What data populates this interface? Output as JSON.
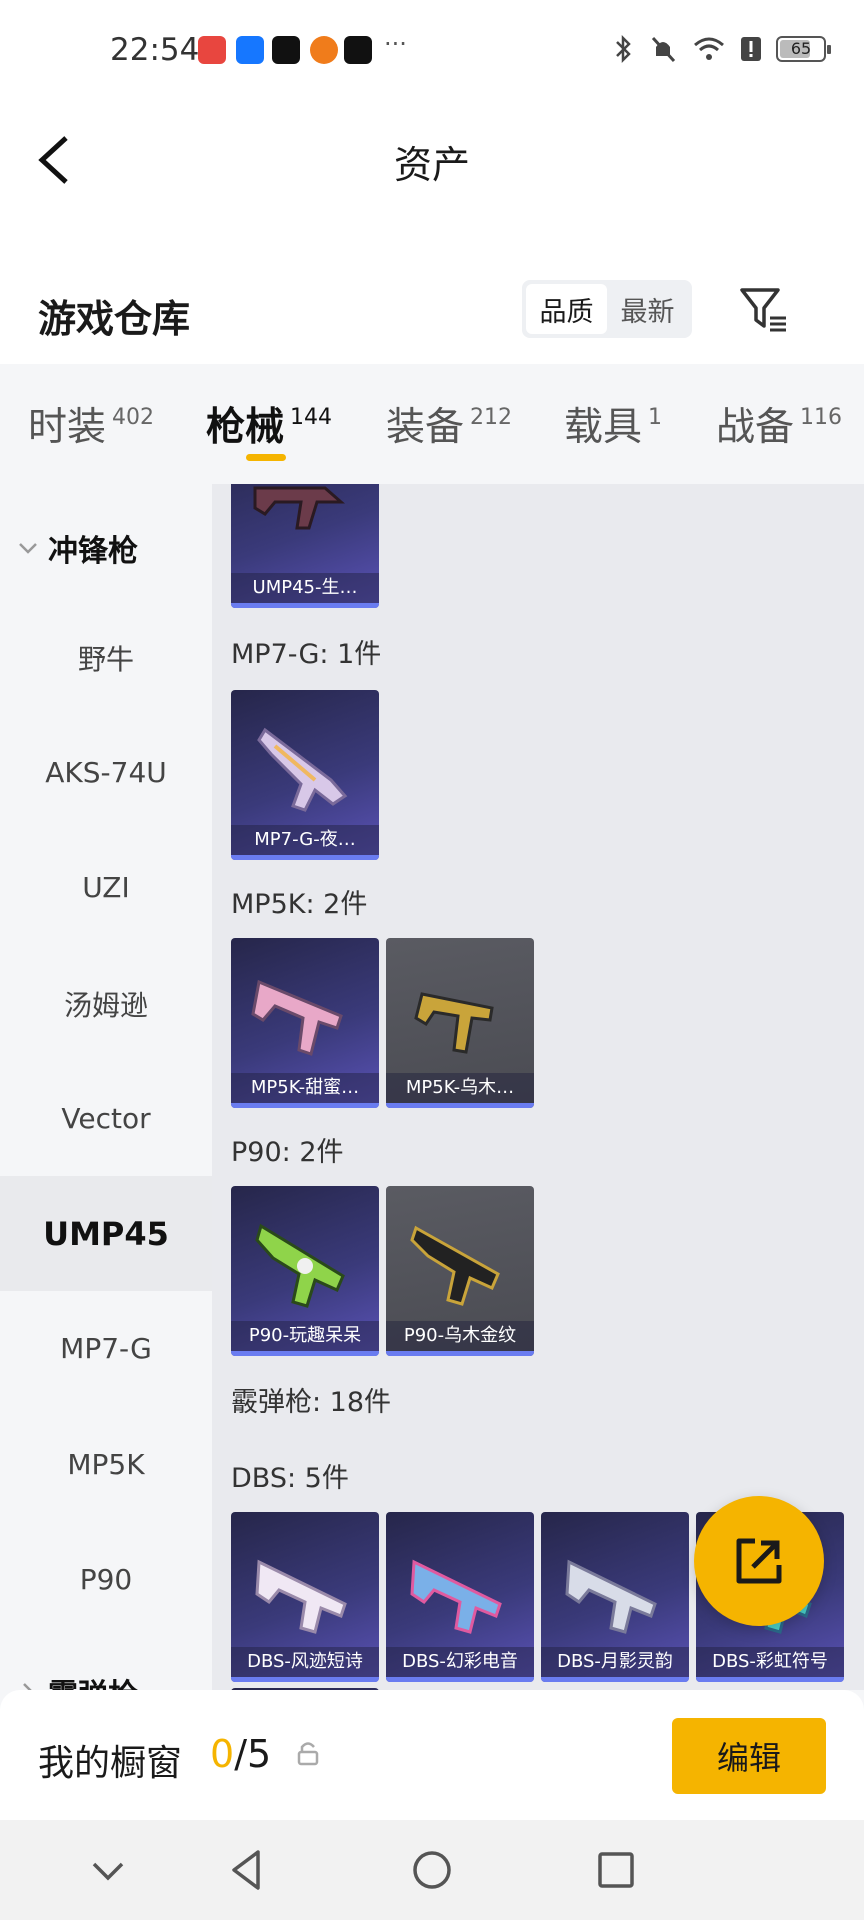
{
  "status_bar": {
    "time": "22:54",
    "battery": "65",
    "apps": [
      "huawei-app-icon",
      "alipay-icon",
      "tiktok-icon",
      "taobao-icon",
      "tiktok-icon"
    ],
    "more": "···"
  },
  "header": {
    "title": "资产"
  },
  "warehouse": {
    "title": "游戏仓库",
    "sort": [
      "品质",
      "最新"
    ]
  },
  "tabs": [
    {
      "label": "时装",
      "count": "402"
    },
    {
      "label": "枪械",
      "count": "144"
    },
    {
      "label": "装备",
      "count": "212"
    },
    {
      "label": "载具",
      "count": "1"
    },
    {
      "label": "战备",
      "count": "116"
    }
  ],
  "sidebar": {
    "group_smg": "冲锋枪",
    "items": [
      "野牛",
      "AKS-74U",
      "UZI",
      "汤姆逊",
      "Vector",
      "UMP45",
      "MP7-G",
      "MP5K",
      "P90"
    ],
    "group_shotgun": "霰弹枪"
  },
  "content": {
    "groups": [
      {
        "label": "",
        "items": [
          {
            "name": "UMP45-生…",
            "bg": "purple"
          }
        ]
      },
      {
        "label": "MP7-G: 1件",
        "items": [
          {
            "name": "MP7-G-夜…",
            "bg": "purple"
          }
        ]
      },
      {
        "label": "MP5K: 2件",
        "items": [
          {
            "name": "MP5K-甜蜜…",
            "bg": "purple"
          },
          {
            "name": "MP5K-乌木…",
            "bg": "gray"
          }
        ]
      },
      {
        "label": "P90: 2件",
        "items": [
          {
            "name": "P90-玩趣呆呆",
            "bg": "purple"
          },
          {
            "name": "P90-乌木金纹",
            "bg": "gray"
          }
        ]
      },
      {
        "label": "霰弹枪: 18件",
        "items": []
      },
      {
        "label": "DBS: 5件",
        "items": [
          {
            "name": "DBS-风迹短诗",
            "bg": "purple"
          },
          {
            "name": "DBS-幻彩电音",
            "bg": "purple"
          },
          {
            "name": "DBS-月影灵韵",
            "bg": "purple"
          },
          {
            "name": "DBS-彩虹符号",
            "bg": "purple"
          }
        ]
      }
    ]
  },
  "showcase": {
    "label": "我的橱窗",
    "current": "0",
    "total": "/5",
    "edit": "编辑"
  },
  "colors": {
    "accent": "#f5b400",
    "card_purple": "#3a3a7a",
    "card_gray": "#55565c"
  }
}
